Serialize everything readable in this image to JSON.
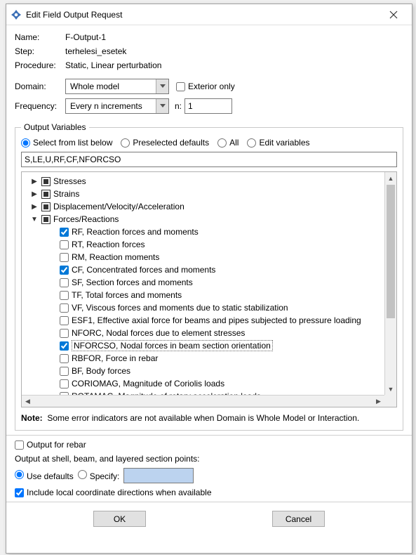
{
  "window": {
    "title": "Edit Field Output Request"
  },
  "form": {
    "name_label": "Name:",
    "name_value": "F-Output-1",
    "step_label": "Step:",
    "step_value": "terhelesi_esetek",
    "procedure_label": "Procedure:",
    "procedure_value": "Static, Linear perturbation",
    "domain_label": "Domain:",
    "domain_value": "Whole model",
    "exterior_only_label": "Exterior only",
    "frequency_label": "Frequency:",
    "frequency_value": "Every n increments",
    "frequency_n_label": "n:",
    "frequency_n_value": "1"
  },
  "output_vars": {
    "legend": "Output Variables",
    "radio_select_list": "Select from list below",
    "radio_preselected": "Preselected defaults",
    "radio_all": "All",
    "radio_edit": "Edit variables",
    "vars_field": "S,LE,U,RF,CF,NFORCSO",
    "categories": [
      {
        "label": "Stresses",
        "expanded": false
      },
      {
        "label": "Strains",
        "expanded": false
      },
      {
        "label": "Displacement/Velocity/Acceleration",
        "expanded": false
      },
      {
        "label": "Forces/Reactions",
        "expanded": true
      }
    ],
    "forces_items": [
      {
        "checked": true,
        "label": "RF, Reaction forces and moments"
      },
      {
        "checked": false,
        "label": "RT, Reaction forces"
      },
      {
        "checked": false,
        "label": "RM, Reaction moments"
      },
      {
        "checked": true,
        "label": "CF, Concentrated forces and moments"
      },
      {
        "checked": false,
        "label": "SF, Section forces and moments"
      },
      {
        "checked": false,
        "label": "TF, Total forces and moments"
      },
      {
        "checked": false,
        "label": "VF, Viscous forces and moments due to static stabilization"
      },
      {
        "checked": false,
        "label": "ESF1, Effective axial force for beams and pipes subjected to pressure loading"
      },
      {
        "checked": false,
        "label": "NFORC, Nodal forces due to element stresses"
      },
      {
        "checked": true,
        "label": "NFORCSO, Nodal forces in beam section orientation",
        "highlighted": true
      },
      {
        "checked": false,
        "label": "RBFOR, Force in rebar"
      },
      {
        "checked": false,
        "label": "BF, Body forces"
      },
      {
        "checked": false,
        "label": "CORIOMAG, Magnitude of Coriolis loads"
      },
      {
        "checked": false,
        "label": "ROTAMAG, Magnitude of rotary acceleration loads"
      }
    ]
  },
  "note": {
    "prefix": "Note:",
    "text": "Some error indicators are not available when Domain is Whole Model or Interaction."
  },
  "rebar": {
    "output_for_rebar_label": "Output for rebar"
  },
  "section_points": {
    "heading": "Output at shell, beam, and layered section points:",
    "use_defaults": "Use defaults",
    "specify": "Specify:"
  },
  "local_coord": {
    "label": "Include local coordinate directions when available"
  },
  "buttons": {
    "ok": "OK",
    "cancel": "Cancel"
  }
}
